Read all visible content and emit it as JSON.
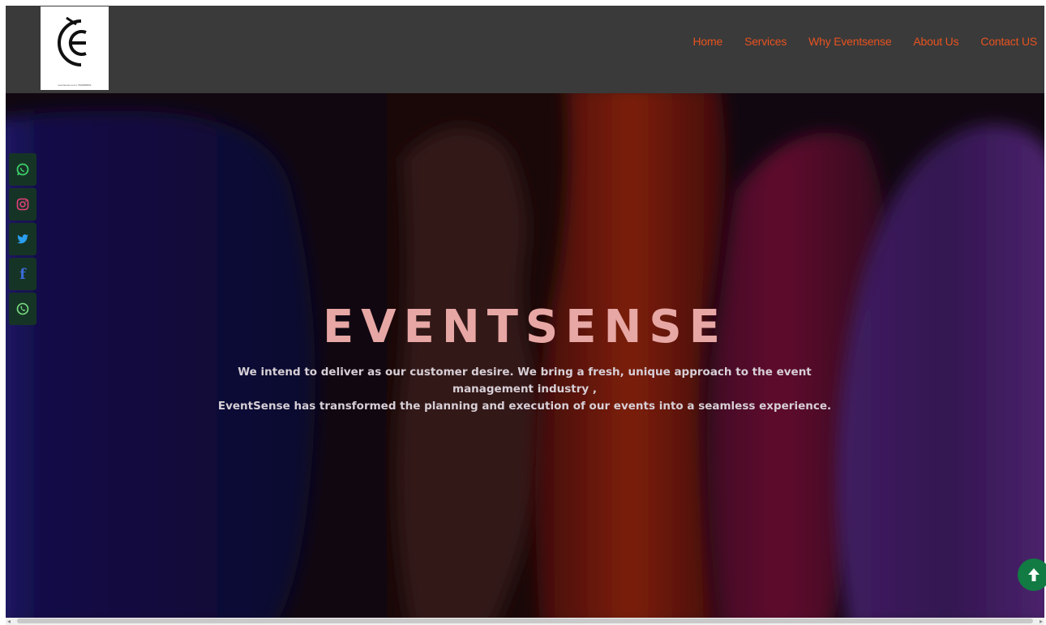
{
  "header": {
    "logo_icon": "eventsense-logo-icon",
    "logo_caption": "eventsense.com | 7904886832",
    "nav": [
      {
        "label": "Home"
      },
      {
        "label": "Services"
      },
      {
        "label": "Why Eventsense"
      },
      {
        "label": "About Us"
      },
      {
        "label": "Contact US"
      }
    ],
    "nav_color": "#e8531f"
  },
  "hero": {
    "title": "EVENTSENSE",
    "line1": "We intend to deliver as our customer desire. We bring a fresh, unique approach to the event management industry ,",
    "line2": "EventSense has transformed the planning and execution of our events into a seamless experience.",
    "title_color": "#e7a7a4"
  },
  "social": {
    "icons": [
      "whatsapp-icon",
      "instagram-icon",
      "twitter-icon",
      "facebook-icon",
      "phone-icon"
    ],
    "facebook_glyph": "f"
  },
  "scroll_top": {
    "icon": "arrow-up-icon"
  }
}
